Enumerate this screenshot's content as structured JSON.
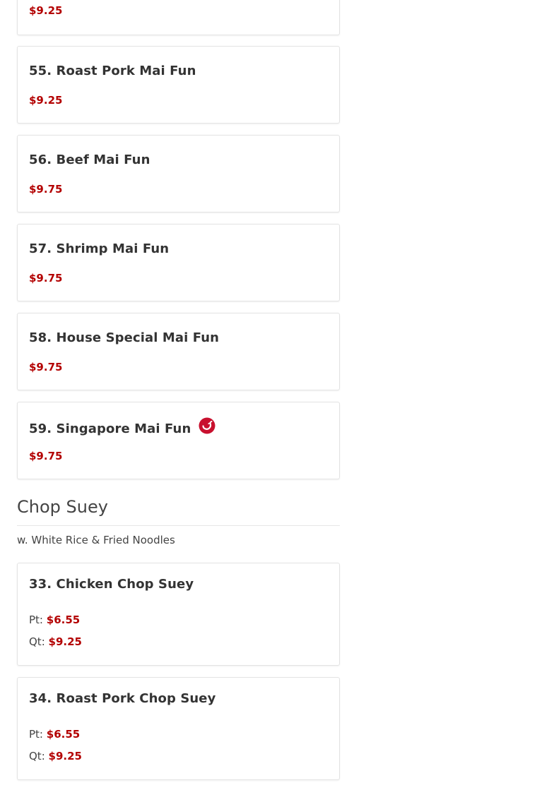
{
  "menu": {
    "top_partial_item": {
      "price": "$9.25"
    },
    "items_mai_fun": [
      {
        "name": "55. Roast Pork Mai Fun",
        "price": "$9.25",
        "spicy": false
      },
      {
        "name": "56. Beef Mai Fun",
        "price": "$9.75",
        "spicy": false
      },
      {
        "name": "57. Shrimp Mai Fun",
        "price": "$9.75",
        "spicy": false
      },
      {
        "name": "58. House Special Mai Fun",
        "price": "$9.75",
        "spicy": false
      },
      {
        "name": "59. Singapore Mai Fun",
        "price": "$9.75",
        "spicy": true,
        "icon": "hot-pepper-icon"
      }
    ],
    "section": {
      "title": "Chop Suey",
      "description": "w. White Rice & Fried Noodles"
    },
    "items_chop_suey": [
      {
        "name": "33. Chicken Chop Suey",
        "sizes": [
          {
            "label": "Pt:",
            "price": "$6.55"
          },
          {
            "label": "Qt:",
            "price": "$9.25"
          }
        ]
      },
      {
        "name": "34. Roast Pork Chop Suey",
        "sizes": [
          {
            "label": "Pt:",
            "price": "$6.55"
          },
          {
            "label": "Qt:",
            "price": "$9.25"
          }
        ]
      }
    ]
  },
  "colors": {
    "price": "#b30000",
    "spicy_icon": "#c8102e",
    "card_border": "#e3e3e3",
    "text": "#333333"
  }
}
